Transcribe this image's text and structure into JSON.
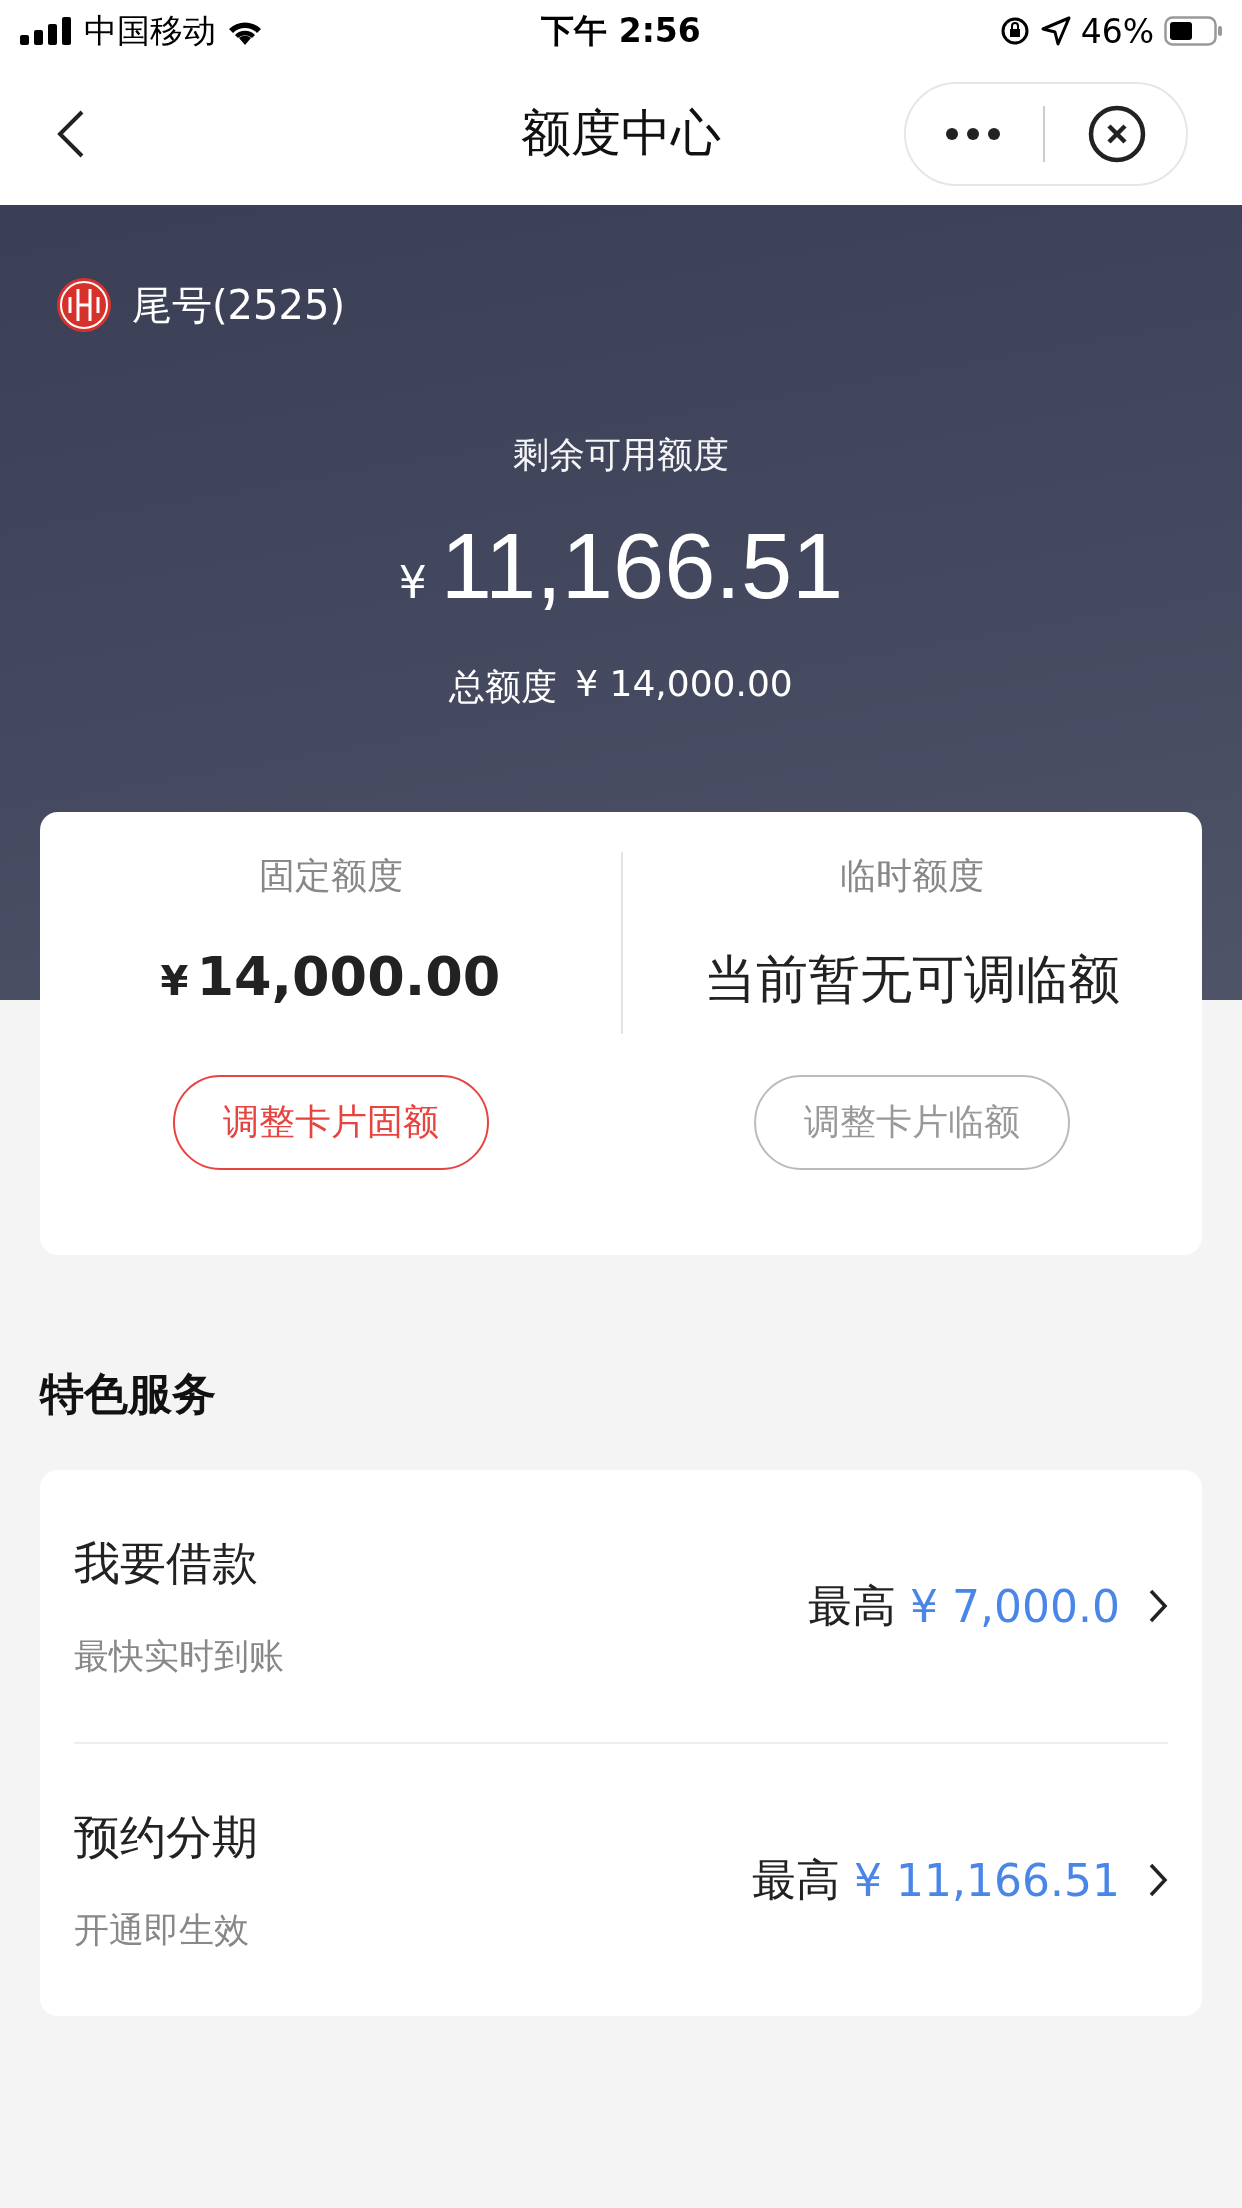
{
  "status_bar": {
    "carrier": "中国移动",
    "time": "下午 2:56",
    "battery": "46%"
  },
  "nav": {
    "title": "额度中心"
  },
  "card_header": {
    "tail": "尾号(2525)",
    "available_label": "剩余可用额度",
    "currency": "¥",
    "available": "11,166.51",
    "total_label": "总额度",
    "total": "¥ 14,000.00"
  },
  "limits": [
    {
      "label": "固定额度",
      "currency": "¥",
      "value": "14,000.00",
      "button": "调整卡片固额",
      "disabled": false
    },
    {
      "label": "临时额度",
      "value": "当前暂无可调临额",
      "button": "调整卡片临额",
      "disabled": true
    }
  ],
  "section_title": "特色服务",
  "services": [
    {
      "title": "我要借款",
      "subtitle": "最快实时到账",
      "prefix": "最高",
      "amount": "¥ 7,000.0"
    },
    {
      "title": "预约分期",
      "subtitle": "开通即生效",
      "prefix": "最高",
      "amount": "¥ 11,166.51"
    }
  ]
}
